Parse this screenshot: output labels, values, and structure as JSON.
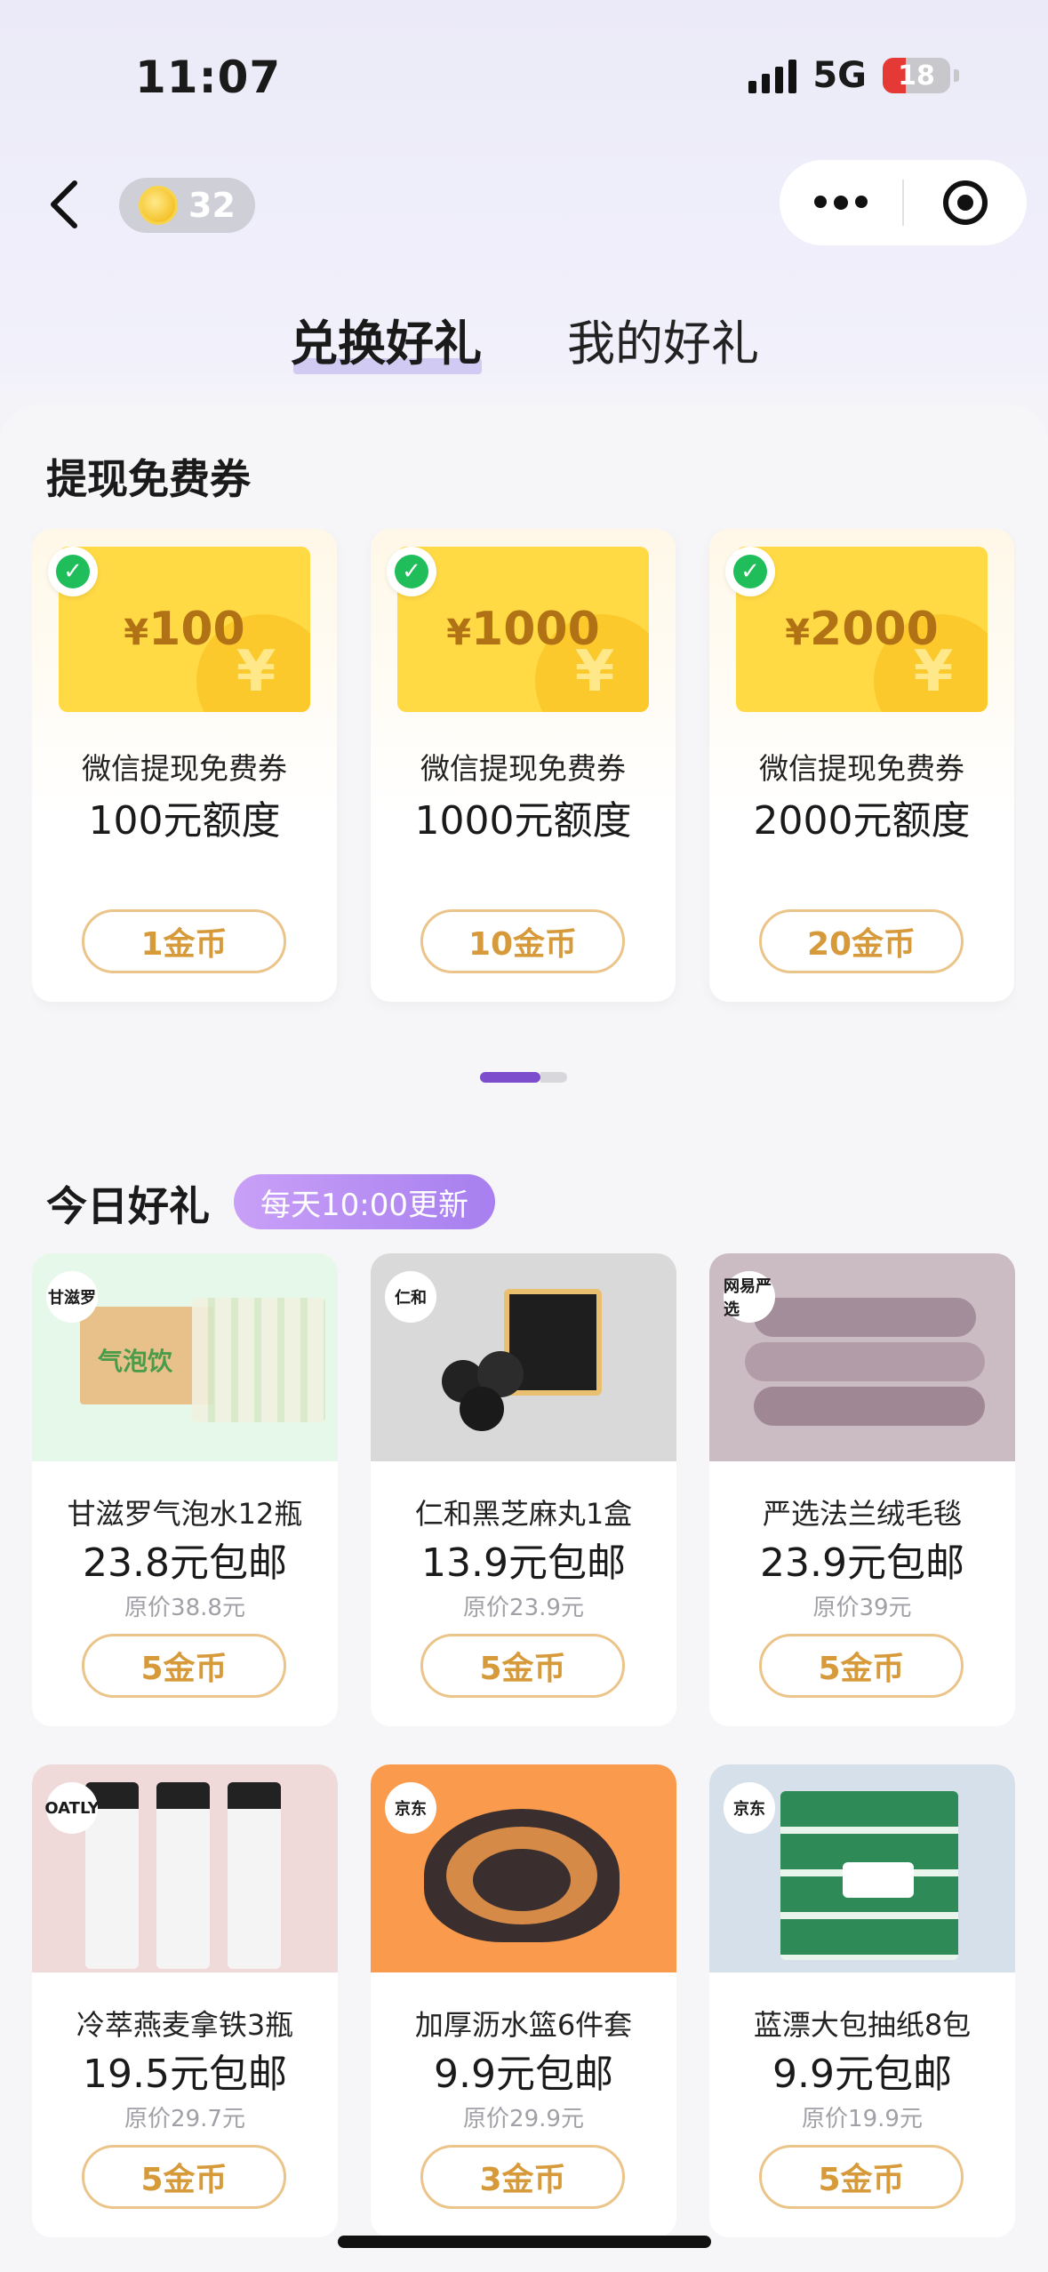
{
  "status_bar": {
    "time": "11:07",
    "network": "5G",
    "battery": "18"
  },
  "header": {
    "coins": "32"
  },
  "tabs": [
    {
      "label": "兑换好礼"
    },
    {
      "label": "我的好礼"
    }
  ],
  "withdraw_section": {
    "title": "提现免费券",
    "cards": [
      {
        "currency": "¥",
        "amount": "100",
        "subtitle": "微信提现免费券",
        "quota": "100元额度",
        "price": "1金币"
      },
      {
        "currency": "¥",
        "amount": "1000",
        "subtitle": "微信提现免费券",
        "quota": "1000元额度",
        "price": "10金币"
      },
      {
        "currency": "¥",
        "amount": "2000",
        "subtitle": "微信提现免费券",
        "quota": "2000元额度",
        "price": "20金币"
      }
    ]
  },
  "daily_section": {
    "title": "今日好礼",
    "badge": "每天10:00更新",
    "products": [
      {
        "name": "甘滋罗气泡水12瓶",
        "price": "23.8元包邮",
        "original": "原价38.8元",
        "cost": "5金币",
        "logo": "甘滋罗",
        "bg": "#e6f8ea"
      },
      {
        "name": "仁和黑芝麻丸1盒",
        "price": "13.9元包邮",
        "original": "原价23.9元",
        "cost": "5金币",
        "logo": "仁和",
        "bg": "#d9d9d9"
      },
      {
        "name": "严选法兰绒毛毯",
        "price": "23.9元包邮",
        "original": "原价39元",
        "cost": "5金币",
        "logo": "网易严选",
        "bg": "#cbbcc4"
      },
      {
        "name": "冷萃燕麦拿铁3瓶",
        "price": "19.5元包邮",
        "original": "原价29.7元",
        "cost": "5金币",
        "logo": "OATLY",
        "bg": "#f0d9d9"
      },
      {
        "name": "加厚沥水篮6件套",
        "price": "9.9元包邮",
        "original": "原价29.9元",
        "cost": "3金币",
        "logo": "京东",
        "bg": "#fa9a4c"
      },
      {
        "name": "蓝漂大包抽纸8包",
        "price": "9.9元包邮",
        "original": "原价19.9元",
        "cost": "5金币",
        "logo": "京东",
        "bg": "#d6e0ea"
      }
    ]
  },
  "colors": {
    "accent_purple": "#7c4dcc",
    "coin_gold": "#d79a3a",
    "coupon_yellow": "#ffda45",
    "wechat_green": "#1fbe5a"
  }
}
